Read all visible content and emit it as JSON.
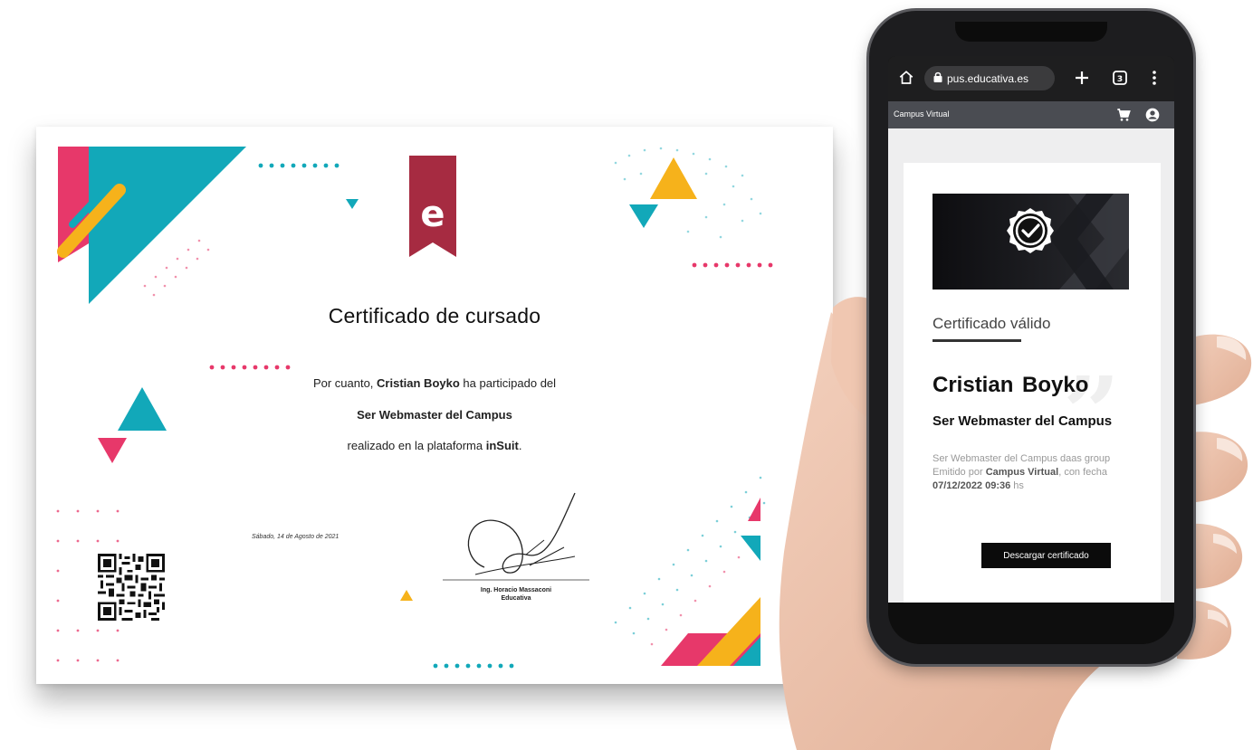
{
  "certificate": {
    "title": "Certificado de cursado",
    "line1_prefix": "Por cuanto, ",
    "student_name": "Cristian Boyko",
    "line1_suffix": " ha participado del",
    "course_name": "Ser Webmaster del Campus",
    "line3_prefix": "realizado en la plataforma ",
    "platform": "inSuit",
    "line3_suffix": ".",
    "date": "Sábado, 14 de Agosto de 2021",
    "signer_name": "Ing. Horacio Massaconi",
    "signer_org": "Educativa",
    "logo_letter": "e"
  },
  "browser": {
    "url": "pus.educativa.es",
    "tabs_count": "3"
  },
  "site": {
    "name": "Campus Virtual"
  },
  "valid_card": {
    "heading": "Certificado válido",
    "student_name": "Cristian  Boyko",
    "course_name": "Ser Webmaster del Campus",
    "course_group": "Ser Webmaster del Campus daas group",
    "issued_prefix": "Emitido por ",
    "issuer": "Campus Virtual",
    "issued_mid": ", con fecha ",
    "issued_datetime": "07/12/2022 09:36",
    "issued_suffix": " hs",
    "download_label": "Descargar certificado"
  },
  "colors": {
    "teal": "#12a8b9",
    "pink": "#e7386a",
    "yellow": "#f6b21b",
    "ribbon": "#a62b41",
    "phone_body": "#1d1d1f"
  }
}
